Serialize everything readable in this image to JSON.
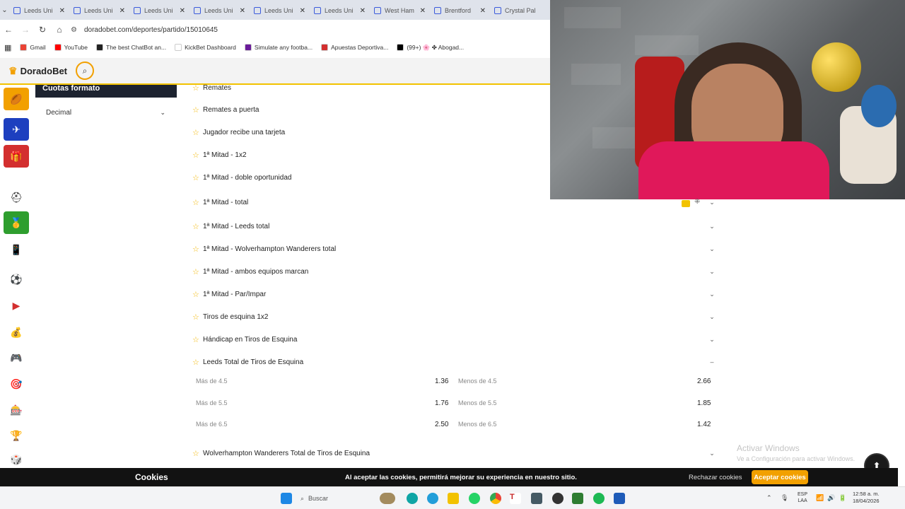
{
  "browser": {
    "tabs": [
      {
        "label": "Leeds Uni",
        "close": "✕"
      },
      {
        "label": "Leeds Uni",
        "close": "✕"
      },
      {
        "label": "Leeds Uni",
        "close": "✕"
      },
      {
        "label": "Leeds Uni",
        "close": "✕"
      },
      {
        "label": "Leeds Uni",
        "close": "✕"
      },
      {
        "label": "Leeds Uni",
        "close": "✕"
      },
      {
        "label": "West Ham",
        "close": "✕"
      },
      {
        "label": "Brentford",
        "close": "✕"
      },
      {
        "label": "Crystal Pal",
        "close": ""
      }
    ],
    "url": "doradobet.com/deportes/partido/15010645",
    "bookmarks": [
      {
        "label": "Gmail",
        "color": "#ea4335"
      },
      {
        "label": "YouTube",
        "color": "#ff0000"
      },
      {
        "label": "The best ChatBot an...",
        "color": "#222222"
      },
      {
        "label": "KickBet Dashboard",
        "color": "#ffffff"
      },
      {
        "label": "Simulate any footba...",
        "color": "#6a1b9a"
      },
      {
        "label": "Apuestas Deportiva...",
        "color": "#d32f2f"
      },
      {
        "label": "(99+) 🌸 ✤ Abogad...",
        "color": "#000000"
      }
    ]
  },
  "site": {
    "logo": "DoradoBet",
    "odds_format_title": "Cuotas formato",
    "odds_format_value": "Decimal"
  },
  "markets": [
    {
      "name": "Remates",
      "chev": ""
    },
    {
      "name": "Remates a puerta",
      "chev": ""
    },
    {
      "name": "Jugador recibe una tarjeta",
      "chev": ""
    },
    {
      "name": "1ª Mitad - 1x2",
      "chev": ""
    },
    {
      "name": "1ª Mitad - doble oportunidad",
      "chev": ""
    },
    {
      "name": "1ª Mitad - total",
      "chev": "⌄"
    },
    {
      "name": "1ª Mitad - Leeds total",
      "chev": "⌄"
    },
    {
      "name": "1ª Mitad - Wolverhampton Wanderers total",
      "chev": "⌄"
    },
    {
      "name": "1ª Mitad - ambos equipos marcan",
      "chev": "⌄"
    },
    {
      "name": "1ª Mitad - Par/Impar",
      "chev": "⌄"
    },
    {
      "name": "Tiros de esquina 1x2",
      "chev": "⌄"
    },
    {
      "name": "Hándicap en Tiros de Esquina",
      "chev": "⌄"
    },
    {
      "name": "Leeds Total de Tiros de Esquina",
      "chev": "–"
    },
    {
      "name": "Wolverhampton Wanderers Total de Tiros de Esquina",
      "chev": "⌄"
    }
  ],
  "odds": [
    {
      "over_label": "Más de 4.5",
      "over_value": "1.36",
      "under_label": "Menos de 4.5",
      "under_value": "2.66"
    },
    {
      "over_label": "Más de 5.5",
      "over_value": "1.76",
      "under_label": "Menos de 5.5",
      "under_value": "1.85"
    },
    {
      "over_label": "Más de 6.5",
      "over_value": "2.50",
      "under_label": "Menos de 6.5",
      "under_value": "1.42"
    }
  ],
  "windows": {
    "activate_title": "Activar Windows",
    "activate_sub": "Ve a Configuración para activar Windows."
  },
  "cookies": {
    "title": "Cookies",
    "message": "Al aceptar las cookies, permitirá mejorar su experiencia en nuestro sitio.",
    "reject": "Rechazar cookies",
    "accept": "Aceptar cookies"
  },
  "taskbar": {
    "search_placeholder": "Buscar",
    "lang_top": "ESP",
    "lang_bottom": "LAA",
    "time": "12:58 a. m.",
    "date": "18/04/2026"
  },
  "colors": {
    "brand_accent": "#f2a000",
    "star": "#f2b600",
    "cookie_bg": "#121212"
  }
}
